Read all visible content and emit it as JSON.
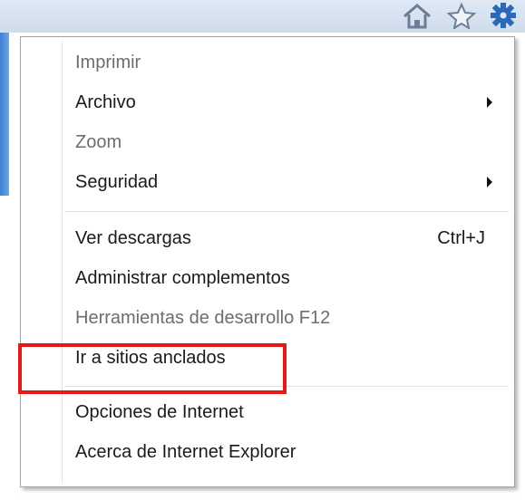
{
  "toolbar": {
    "icons": [
      "home-icon",
      "favorites-star-icon",
      "tools-gear-icon"
    ]
  },
  "menu": {
    "items": [
      {
        "label": "Imprimir",
        "enabled": false
      },
      {
        "label": "Archivo",
        "enabled": true,
        "submenu": true
      },
      {
        "label": "Zoom",
        "enabled": false
      },
      {
        "label": "Seguridad",
        "enabled": true,
        "submenu": true
      },
      {
        "label": "Ver descargas",
        "enabled": true,
        "shortcut": "Ctrl+J"
      },
      {
        "label": "Administrar complementos",
        "enabled": true
      },
      {
        "label": "Herramientas de desarrollo F12",
        "enabled": false
      },
      {
        "label": "Ir a sitios anclados",
        "enabled": true
      },
      {
        "label": "Opciones de Internet",
        "enabled": true,
        "highlighted": true
      },
      {
        "label": "Acerca de Internet Explorer",
        "enabled": true
      }
    ]
  },
  "colors": {
    "highlight_box": "#e11b1b",
    "disabled_text": "#6d6d6d",
    "enabled_text": "#1a1a1a"
  }
}
